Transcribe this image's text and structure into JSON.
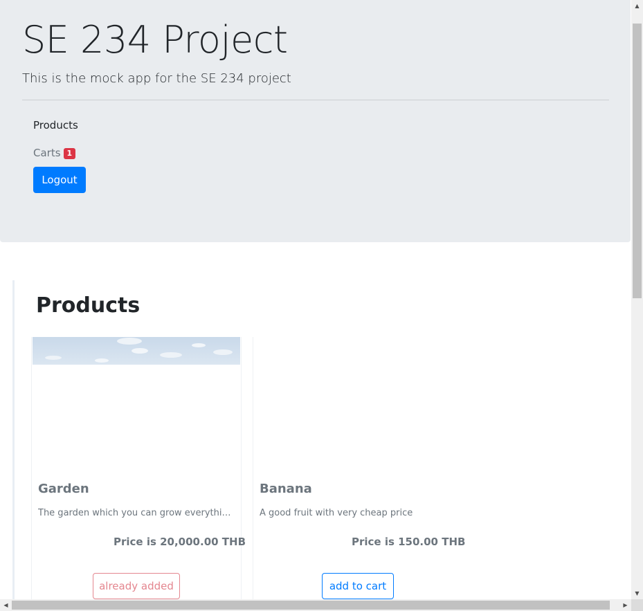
{
  "header": {
    "title": "SE 234 Project",
    "lead": "This is the mock app for the SE 234 project"
  },
  "nav": {
    "products_label": "Products",
    "carts_label": "Carts",
    "carts_count": "1",
    "logout_label": "Logout"
  },
  "main": {
    "heading": "Products",
    "products": [
      {
        "name": "Garden",
        "description": "The garden which you can grow everything on earth",
        "price": "Price is 20,000.00 THB",
        "action_label": "already added"
      },
      {
        "name": "Banana",
        "description": "A good fruit with very cheap price",
        "price": "Price is 150.00 THB",
        "action_label": "add to cart"
      }
    ]
  },
  "colors": {
    "primary": "#007bff",
    "danger": "#dc3545",
    "jumbotron_bg": "#e9ecef",
    "muted": "#6c757d"
  }
}
